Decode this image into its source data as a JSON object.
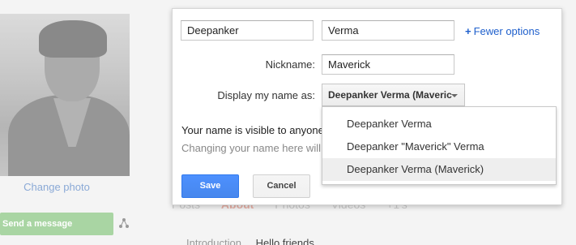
{
  "profile": {
    "change_photo": "Change photo",
    "send_message": "Send a message",
    "tabs": [
      "Posts",
      "About",
      "Photos",
      "Videos",
      "+1's"
    ],
    "intro_label": "Introduction",
    "intro_value": "Hello friends"
  },
  "dialog": {
    "first_name": "Deepanker",
    "last_name": "Verma",
    "fewer_options": "Fewer options",
    "nickname_label": "Nickname:",
    "nickname": "Maverick",
    "display_label": "Display my name as:",
    "display_selected": "Deepanker Verma (Maveric",
    "visible_text": "Your name is visible to anyone",
    "changing_text": "Changing your name here will",
    "save": "Save",
    "cancel": "Cancel"
  },
  "dropdown": {
    "options": [
      "Deepanker Verma",
      "Deepanker \"Maverick\" Verma",
      "Deepanker Verma (Maverick)"
    ],
    "selected_index": 2
  }
}
